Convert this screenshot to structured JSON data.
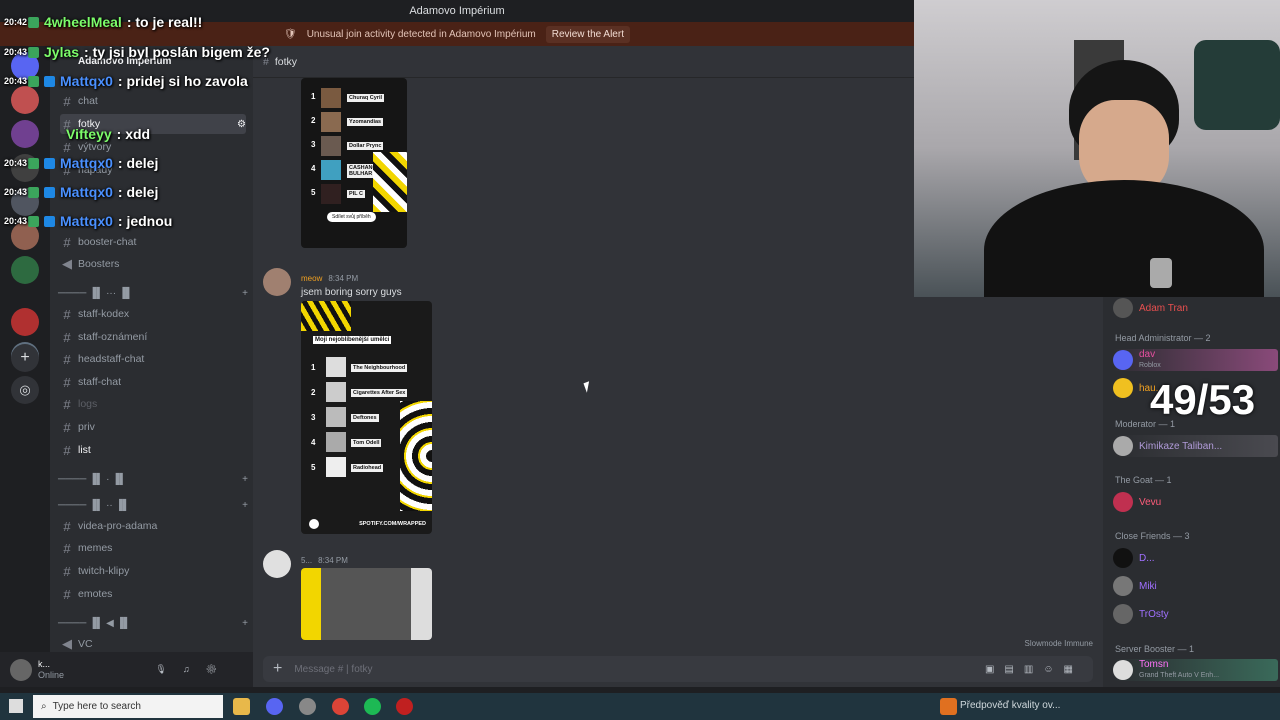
{
  "window": {
    "title": "Adamovo Impérium"
  },
  "alert": {
    "text": "Unusual join activity detected in Adamovo Impérium",
    "button": "Review the Alert"
  },
  "server": {
    "name": "Adamovo Impérium"
  },
  "channel_header": {
    "name": "fotky"
  },
  "channels": [
    {
      "name": "chat",
      "top": 0
    },
    {
      "name": "fotky"
    },
    {
      "name": "výtvory"
    },
    {
      "name": "nápady"
    },
    {
      "name": "booster-chat"
    },
    {
      "name": "Boosters"
    },
    {
      "name": "staff-kodex"
    },
    {
      "name": "staff-oznámení"
    },
    {
      "name": "headstaff-chat"
    },
    {
      "name": "staff-chat"
    },
    {
      "name": "logs"
    },
    {
      "name": "priv"
    },
    {
      "name": "list"
    },
    {
      "name": "videa-pro-adama"
    },
    {
      "name": "memes"
    },
    {
      "name": "twitch-klipy"
    },
    {
      "name": "emotes"
    },
    {
      "name": "VC"
    }
  ],
  "messages": [
    {
      "author": "meow",
      "time": "8:34 PM",
      "text": "jsem boring sorry guys",
      "card_title": "Moji nejoblíbenější umělci",
      "artists": [
        "The Neighbourhood",
        "Cigarettes After Sex",
        "Deftones",
        "Tom Odell",
        "Radiohead"
      ],
      "footer": "SPOTIFY.COM/WRAPPED"
    },
    {
      "author": "5...",
      "time": "8:34 PM"
    }
  ],
  "first_card": {
    "artists": [
      "Churaq Cyril",
      "Yzomandias",
      "Dollar Prync",
      "CASHANOVA BULHAR",
      "PIL C"
    ],
    "share": "Sdílet svůj příběh"
  },
  "composer": {
    "placeholder": "Message # | fotky",
    "slowmode": "Slowmode Immune"
  },
  "user": {
    "name": "k...",
    "status": "Online"
  },
  "members": {
    "groups": [
      {
        "title": "Head Administrator — 2"
      },
      {
        "title": "Moderator — 1"
      },
      {
        "title": "The Goat — 1"
      },
      {
        "title": "Close Friends — 3"
      },
      {
        "title": "Server Booster — 1"
      }
    ],
    "items": [
      {
        "name": "Adam Tran",
        "color": "#e84f4f"
      },
      {
        "name": "dav",
        "sub": "Roblox",
        "color": "#e84fa0"
      },
      {
        "name": "hau...",
        "color": "#f0a020"
      },
      {
        "name": "Kimikaze Taliban...",
        "color": "#b19bd9"
      },
      {
        "name": "Vevu",
        "color": "#ff5c7a"
      },
      {
        "name": "D...",
        "color": "#a070ff"
      },
      {
        "name": "Miki",
        "color": "#a070ff"
      },
      {
        "name": "TrOsty",
        "color": "#a070ff"
      },
      {
        "name": "Tomsn",
        "sub": "Grand Theft Auto V Enh...",
        "color": "#ff73fa"
      }
    ]
  },
  "overlay": {
    "counter": "49/53"
  },
  "stream_chat": [
    {
      "time": "20:42",
      "user": "4wheelMeal",
      "msg": ": to je real!!",
      "color": "#7cfc6a"
    },
    {
      "time": "20:43",
      "user": "Jylas",
      "msg": ": ty jsi byl poslán bigem že?",
      "color": "#7cfc6a"
    },
    {
      "time": "20:43",
      "user": "Mattqx0",
      "msg": ": pridej si ho zavola",
      "color": "#4a90ff"
    },
    {
      "time": "20:43",
      "user": "Vifteyy",
      "msg": ": xdd",
      "color": "#7cfc6a"
    },
    {
      "time": "20:43",
      "user": "Mattqx0",
      "msg": ": delej",
      "color": "#4a90ff"
    },
    {
      "time": "20:43",
      "user": "Mattqx0",
      "msg": ": delej",
      "color": "#4a90ff"
    },
    {
      "time": "20:43",
      "user": "Mattqx0",
      "msg": ": jednou",
      "color": "#4a90ff"
    }
  ],
  "taskbar": {
    "search": "Type here to search",
    "news": "Předpověď kvality ov..."
  }
}
